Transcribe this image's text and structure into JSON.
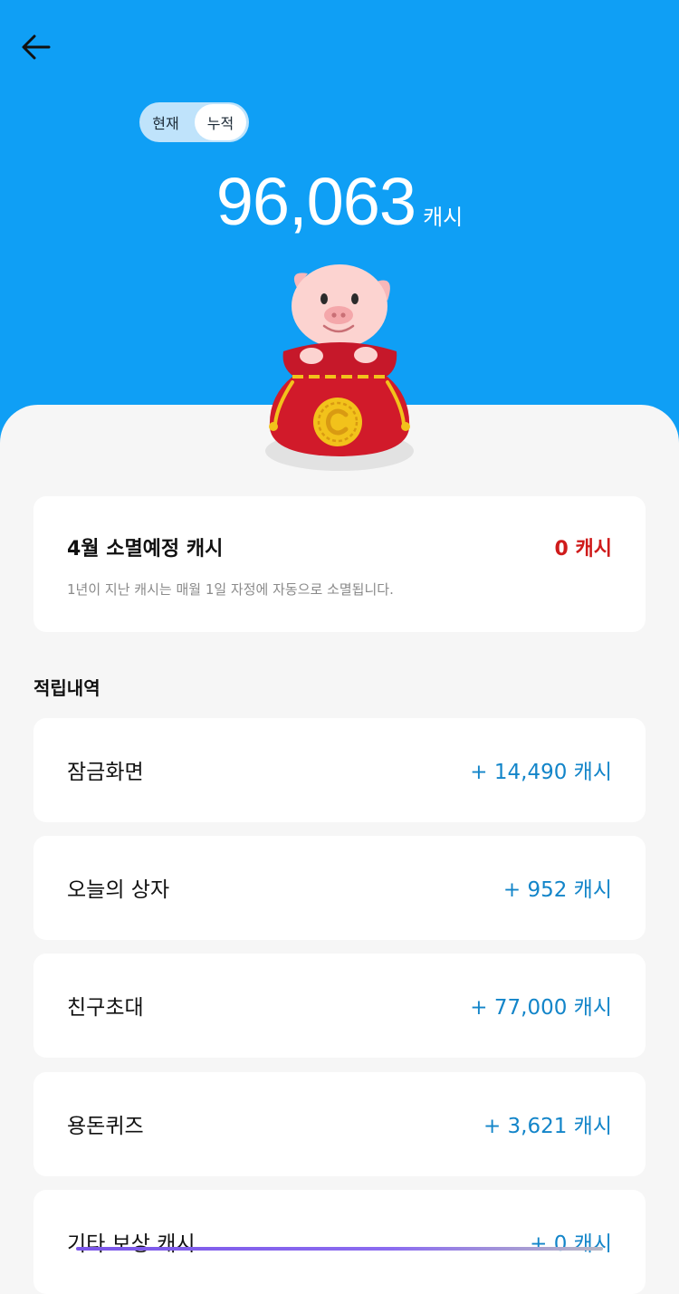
{
  "header": {
    "toggle": {
      "current_label": "현재",
      "total_label": "누적",
      "selected": "누적"
    },
    "total_amount": "96,063",
    "total_unit": "캐시"
  },
  "expiring": {
    "title": "4월 소멸예정 캐시",
    "amount": "0 캐시",
    "note": "1년이 지난 캐시는 매월 1일 자정에 자동으로 소멸됩니다."
  },
  "history": {
    "title": "적립내역",
    "items": [
      {
        "label": "잠금화면",
        "value": "+ 14,490 캐시"
      },
      {
        "label": "오늘의 상자",
        "value": "+ 952 캐시"
      },
      {
        "label": "친구초대",
        "value": "+ 77,000 캐시"
      },
      {
        "label": "용돈퀴즈",
        "value": "+ 3,621 캐시"
      },
      {
        "label": "기타 보상 캐시",
        "value": "+ 0 캐시"
      }
    ]
  },
  "icons": {
    "back": "arrow-left-icon",
    "mascot": "pig-in-pouch-icon",
    "coin": "coin-c-icon"
  },
  "colors": {
    "primary": "#0f9ff5",
    "expire_red": "#cf1b1b",
    "value_blue": "#1385c9"
  }
}
